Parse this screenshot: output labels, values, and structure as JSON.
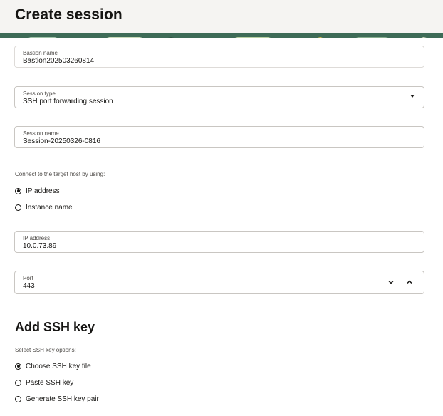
{
  "header": {
    "title": "Create session"
  },
  "fields": {
    "bastion_name": {
      "label": "Bastion name",
      "value": "Bastion202503260814"
    },
    "session_type": {
      "label": "Session type",
      "value": "SSH port forwarding session"
    },
    "session_name": {
      "label": "Session name",
      "value": "Session-20250326-0816"
    },
    "ip_address": {
      "label": "IP address",
      "value": "10.0.73.89"
    },
    "port": {
      "label": "Port",
      "value": "443"
    }
  },
  "connect": {
    "label": "Connect to the target host by using:",
    "options": [
      {
        "label": "IP address",
        "checked": true
      },
      {
        "label": "Instance name",
        "checked": false
      }
    ]
  },
  "ssh_key": {
    "title": "Add SSH key",
    "label": "Select SSH key options:",
    "options": [
      {
        "label": "Choose SSH key file",
        "checked": true
      },
      {
        "label": "Paste SSH key",
        "checked": false
      },
      {
        "label": "Generate SSH key pair",
        "checked": false
      }
    ]
  },
  "icons": {
    "dropdown": "chevron-down-icon",
    "decrement": "chevron-down-icon",
    "increment": "chevron-up-icon"
  },
  "colors": {
    "header_bg": "#f5f4f2",
    "banner": "#3e6b57",
    "text": "#161513"
  }
}
